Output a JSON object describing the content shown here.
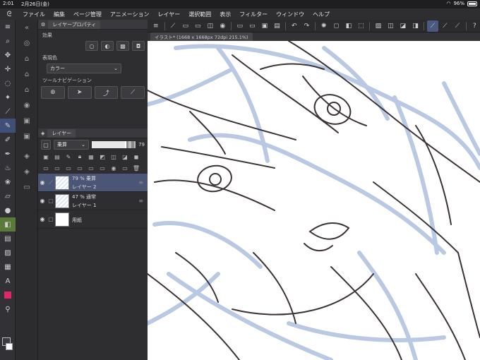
{
  "status": {
    "time": "2:01",
    "date": "2月26日(金)",
    "battery": "96%",
    "battery_level": 0.96
  },
  "menu": {
    "items": [
      "ファイル",
      "編集",
      "ページ管理",
      "アニメーション",
      "レイヤー",
      "選択範囲",
      "表示",
      "フィルター",
      "ウィンドウ",
      "ヘルプ"
    ]
  },
  "property_panel": {
    "tab": "レイヤープロパティ",
    "effect_label": "効果",
    "display_color_label": "表現色",
    "display_color_value": "カラー",
    "tool_nav_label": "ツールナビゲーション"
  },
  "layer_panel": {
    "tab": "レイヤー",
    "blend_mode": "乗算",
    "opacity": 79,
    "layers": [
      {
        "line1": "79 % 乗算",
        "line2": "レイヤー 2",
        "selected": true
      },
      {
        "line1": "47 % 通常",
        "line2": "レイヤー 1",
        "selected": false
      },
      {
        "line1": "",
        "line2": "用紙",
        "selected": false
      }
    ]
  },
  "document": {
    "tab_title": "イラスト* (1668 x 1668px 72dpi 215.1%)"
  },
  "colors": {
    "accent": "#4b5677",
    "highlight": "#3f4f78",
    "sketch_blue": "#b9c9e3",
    "ink": "#3b3335",
    "subcolor_pink": "#e0256a"
  },
  "icons": {
    "tools": [
      "menu-icon",
      "zoom-icon",
      "hand-icon",
      "move-icon",
      "lasso-icon",
      "auto-select-icon",
      "eyedropper-icon",
      "pen-icon",
      "pencil-icon",
      "brush-icon",
      "airbrush-icon",
      "decoration-icon",
      "eraser-icon",
      "blend-icon",
      "fill-icon",
      "gradient-icon",
      "shape-icon",
      "frame-icon",
      "text-icon",
      "balloon-icon",
      "correction-icon"
    ]
  }
}
